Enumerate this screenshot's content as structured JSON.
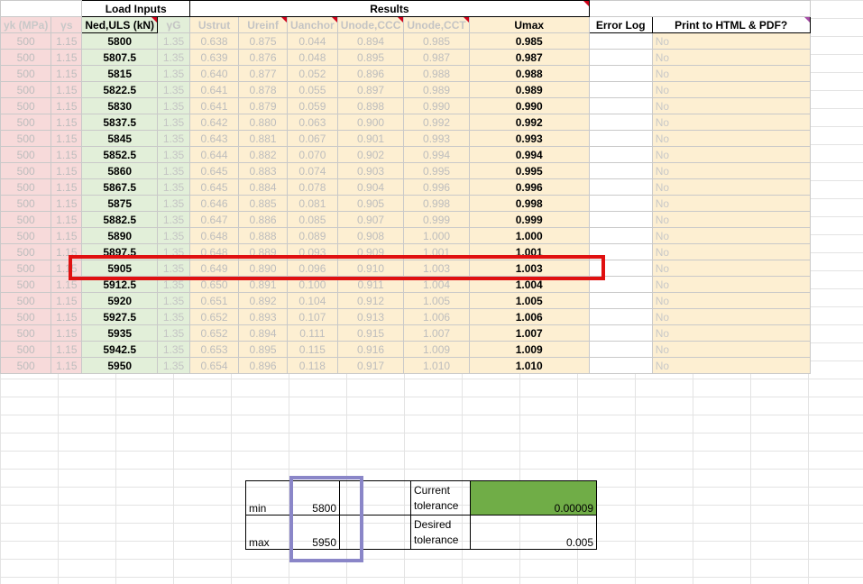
{
  "headers": {
    "load_inputs": "Load Inputs",
    "results": "Results",
    "cols": [
      "yk (MPa)",
      "γs",
      "Ned,ULS (kN)",
      "γG",
      "Ustrut",
      "Ureinf",
      "Uanchor",
      "Unode,CCC",
      "Unode,CCT",
      "Umax",
      "Error Log",
      "Print to HTML & PDF?"
    ]
  },
  "rows": [
    [
      "500",
      "1.15",
      "5800",
      "1.35",
      "0.638",
      "0.875",
      "0.044",
      "0.894",
      "0.985",
      "0.985",
      "",
      "No"
    ],
    [
      "500",
      "1.15",
      "5807.5",
      "1.35",
      "0.639",
      "0.876",
      "0.048",
      "0.895",
      "0.987",
      "0.987",
      "",
      "No"
    ],
    [
      "500",
      "1.15",
      "5815",
      "1.35",
      "0.640",
      "0.877",
      "0.052",
      "0.896",
      "0.988",
      "0.988",
      "",
      "No"
    ],
    [
      "500",
      "1.15",
      "5822.5",
      "1.35",
      "0.641",
      "0.878",
      "0.055",
      "0.897",
      "0.989",
      "0.989",
      "",
      "No"
    ],
    [
      "500",
      "1.15",
      "5830",
      "1.35",
      "0.641",
      "0.879",
      "0.059",
      "0.898",
      "0.990",
      "0.990",
      "",
      "No"
    ],
    [
      "500",
      "1.15",
      "5837.5",
      "1.35",
      "0.642",
      "0.880",
      "0.063",
      "0.900",
      "0.992",
      "0.992",
      "",
      "No"
    ],
    [
      "500",
      "1.15",
      "5845",
      "1.35",
      "0.643",
      "0.881",
      "0.067",
      "0.901",
      "0.993",
      "0.993",
      "",
      "No"
    ],
    [
      "500",
      "1.15",
      "5852.5",
      "1.35",
      "0.644",
      "0.882",
      "0.070",
      "0.902",
      "0.994",
      "0.994",
      "",
      "No"
    ],
    [
      "500",
      "1.15",
      "5860",
      "1.35",
      "0.645",
      "0.883",
      "0.074",
      "0.903",
      "0.995",
      "0.995",
      "",
      "No"
    ],
    [
      "500",
      "1.15",
      "5867.5",
      "1.35",
      "0.645",
      "0.884",
      "0.078",
      "0.904",
      "0.996",
      "0.996",
      "",
      "No"
    ],
    [
      "500",
      "1.15",
      "5875",
      "1.35",
      "0.646",
      "0.885",
      "0.081",
      "0.905",
      "0.998",
      "0.998",
      "",
      "No"
    ],
    [
      "500",
      "1.15",
      "5882.5",
      "1.35",
      "0.647",
      "0.886",
      "0.085",
      "0.907",
      "0.999",
      "0.999",
      "",
      "No"
    ],
    [
      "500",
      "1.15",
      "5890",
      "1.35",
      "0.648",
      "0.888",
      "0.089",
      "0.908",
      "1.000",
      "1.000",
      "",
      "No"
    ],
    [
      "500",
      "1.15",
      "5897.5",
      "1.35",
      "0.648",
      "0.889",
      "0.093",
      "0.909",
      "1.001",
      "1.001",
      "",
      "No"
    ],
    [
      "500",
      "1.15",
      "5905",
      "1.35",
      "0.649",
      "0.890",
      "0.096",
      "0.910",
      "1.003",
      "1.003",
      "",
      "No"
    ],
    [
      "500",
      "1.15",
      "5912.5",
      "1.35",
      "0.650",
      "0.891",
      "0.100",
      "0.911",
      "1.004",
      "1.004",
      "",
      "No"
    ],
    [
      "500",
      "1.15",
      "5920",
      "1.35",
      "0.651",
      "0.892",
      "0.104",
      "0.912",
      "1.005",
      "1.005",
      "",
      "No"
    ],
    [
      "500",
      "1.15",
      "5927.5",
      "1.35",
      "0.652",
      "0.893",
      "0.107",
      "0.913",
      "1.006",
      "1.006",
      "",
      "No"
    ],
    [
      "500",
      "1.15",
      "5935",
      "1.35",
      "0.652",
      "0.894",
      "0.111",
      "0.915",
      "1.007",
      "1.007",
      "",
      "No"
    ],
    [
      "500",
      "1.15",
      "5942.5",
      "1.35",
      "0.653",
      "0.895",
      "0.115",
      "0.916",
      "1.009",
      "1.009",
      "",
      "No"
    ],
    [
      "500",
      "1.15",
      "5950",
      "1.35",
      "0.654",
      "0.896",
      "0.118",
      "0.917",
      "1.010",
      "1.010",
      "",
      "No"
    ]
  ],
  "tolerance": {
    "min_label": "min",
    "min_value": "5800",
    "max_label": "max",
    "max_value": "5950",
    "current_label": "Current tolerance",
    "current_value": "0.00009",
    "desired_label": "Desired tolerance",
    "desired_value": "0.005"
  },
  "colors": {
    "highlight_border": "#e01010",
    "range_border": "#8a86c8",
    "current_tolerance_fill": "#70ad47"
  }
}
